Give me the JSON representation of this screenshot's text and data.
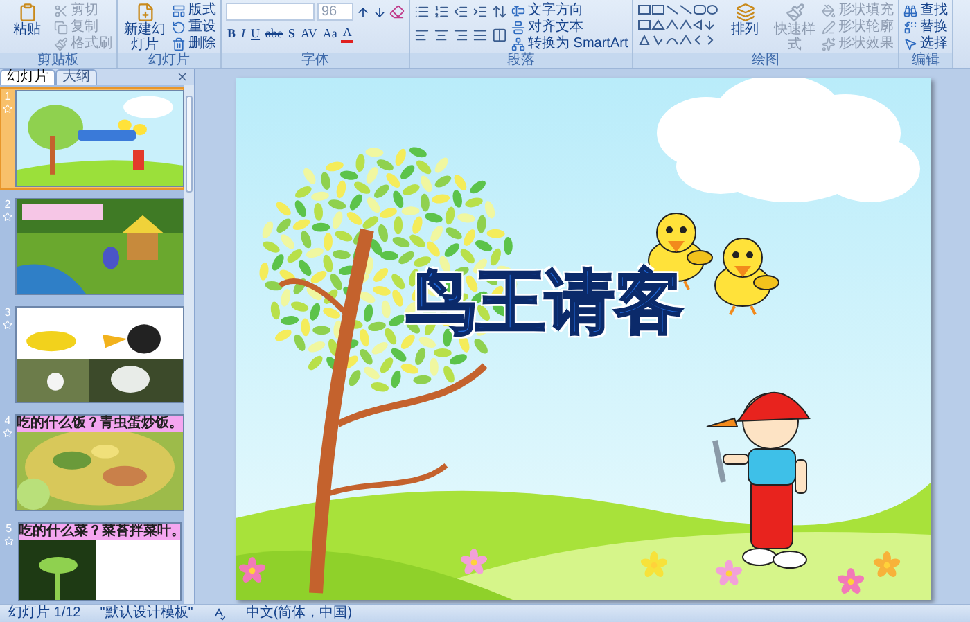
{
  "ribbon": {
    "groups": [
      {
        "label": "剪贴板",
        "kind": "basic",
        "buttons": [
          {
            "label": "粘贴",
            "kind": "large",
            "disabled": false
          },
          {
            "label": "剪切",
            "kind": "small",
            "disabled": true
          },
          {
            "label": "复制",
            "kind": "small",
            "disabled": true
          },
          {
            "label": "格式刷",
            "kind": "small",
            "disabled": true
          }
        ]
      },
      {
        "label": "幻灯片",
        "kind": "basic",
        "buttons": [
          {
            "label": "新建幻灯片",
            "kind": "large",
            "disabled": false
          },
          {
            "label": "版式",
            "kind": "small",
            "disabled": false
          },
          {
            "label": "重设",
            "kind": "small",
            "disabled": false
          },
          {
            "label": "删除",
            "kind": "small",
            "disabled": false
          }
        ]
      },
      {
        "label": "字体",
        "kind": "font",
        "font_size": "96",
        "format_buttons": [
          "B",
          "I",
          "U",
          "abe",
          "S",
          "AV",
          "Aa",
          "A"
        ]
      },
      {
        "label": "段落",
        "kind": "paragraph",
        "buttons": [
          {
            "label": "文字方向",
            "kind": "small",
            "disabled": false
          },
          {
            "label": "对齐文本",
            "kind": "small",
            "disabled": false
          },
          {
            "label": "转换为 SmartArt",
            "kind": "small",
            "disabled": false
          }
        ]
      },
      {
        "label": "绘图",
        "kind": "drawing",
        "buttons": [
          {
            "label": "排列",
            "kind": "large",
            "disabled": false
          },
          {
            "label": "快速样式",
            "kind": "large",
            "disabled": true
          },
          {
            "label": "形状填充",
            "kind": "small",
            "disabled": true
          },
          {
            "label": "形状轮廓",
            "kind": "small",
            "disabled": true
          },
          {
            "label": "形状效果",
            "kind": "small",
            "disabled": true
          }
        ]
      },
      {
        "label": "编辑",
        "kind": "basic",
        "buttons": [
          {
            "label": "查找",
            "kind": "small",
            "disabled": false
          },
          {
            "label": "替换",
            "kind": "small",
            "disabled": false
          },
          {
            "label": "选择",
            "kind": "small",
            "disabled": false
          }
        ]
      }
    ]
  },
  "panel_tabs": [
    {
      "label": "幻灯片",
      "selected": true
    },
    {
      "label": "大纲",
      "selected": false
    }
  ],
  "slides": [
    {
      "number": "1",
      "selected": true
    },
    {
      "number": "2",
      "selected": false
    },
    {
      "number": "3",
      "selected": false
    },
    {
      "number": "4",
      "selected": false,
      "caption": "吃的什么饭？青虫蛋炒饭。"
    },
    {
      "number": "5",
      "selected": false,
      "caption": "吃的什么菜？菜苔拌菜叶。"
    }
  ],
  "slide": {
    "title": "鸟王请客"
  },
  "status_bar": [
    "幻灯片 1/12",
    "\"默认设计模板\"",
    "中文(简体，中国)"
  ]
}
